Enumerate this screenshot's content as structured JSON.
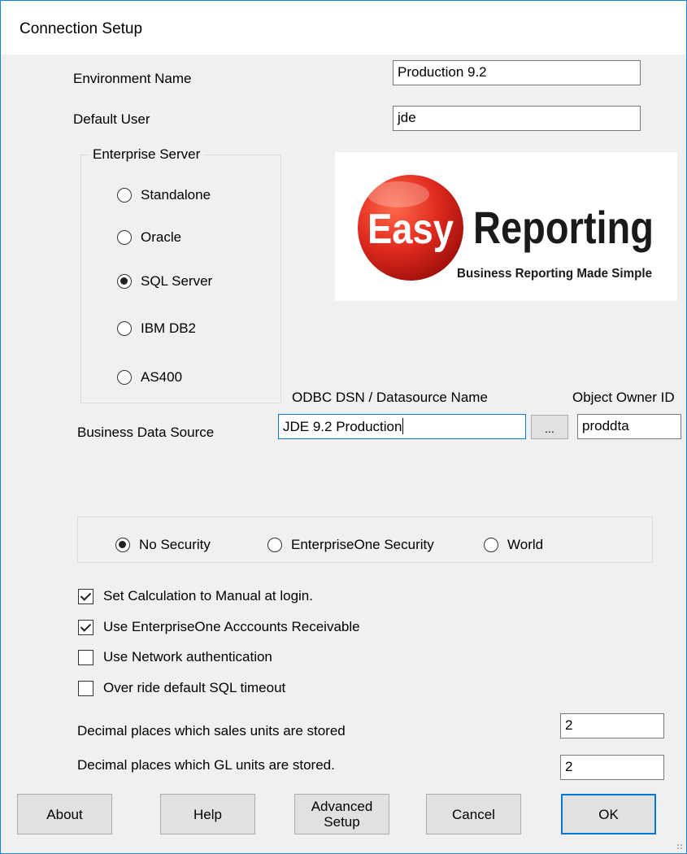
{
  "window": {
    "title": "Connection Setup"
  },
  "environment": {
    "label": "Environment Name",
    "value": "Production 9.2"
  },
  "default_user": {
    "label": "Default User",
    "value": "jde"
  },
  "enterprise_server": {
    "title": "Enterprise Server",
    "options": [
      {
        "label": "Standalone",
        "selected": false
      },
      {
        "label": "Oracle",
        "selected": false
      },
      {
        "label": "SQL Server",
        "selected": true
      },
      {
        "label": "IBM DB2",
        "selected": false
      },
      {
        "label": "AS400",
        "selected": false
      }
    ]
  },
  "logo": {
    "brand_word_1": "Easy",
    "brand_word_2": "Reporting",
    "tagline": "Business Reporting Made Simple",
    "colors": {
      "ball": "#e02a1e",
      "ball_dark": "#a0100c",
      "text": "#1a1a1a"
    }
  },
  "data_source": {
    "label": "Business Data Source",
    "dsn_header": "ODBC DSN / Datasource Name",
    "dsn_value": "JDE 9.2 Production",
    "browse_label": "...",
    "owner_header": "Object Owner ID",
    "owner_value": "proddta"
  },
  "security": {
    "options": [
      {
        "label": "No Security",
        "selected": true
      },
      {
        "label": "EnterpriseOne Security",
        "selected": false
      },
      {
        "label": "World",
        "selected": false
      }
    ]
  },
  "options": [
    {
      "label": "Set Calculation to Manual at login.",
      "checked": true
    },
    {
      "label": "Use EnterpriseOne Acccounts Receivable",
      "checked": true
    },
    {
      "label": "Use Network authentication",
      "checked": false
    },
    {
      "label": "Over ride default SQL timeout",
      "checked": false
    }
  ],
  "decimals": {
    "sales_label": "Decimal places which sales units are stored",
    "sales_value": "2",
    "gl_label": "Decimal places which GL units are stored.",
    "gl_value": "2"
  },
  "buttons": {
    "about": "About",
    "help": "Help",
    "advanced": "Advanced\nSetup",
    "cancel": "Cancel",
    "ok": "OK"
  },
  "colors": {
    "accent": "#0078d7",
    "window_border": "#1883d7",
    "background": "#f0f0f0"
  }
}
